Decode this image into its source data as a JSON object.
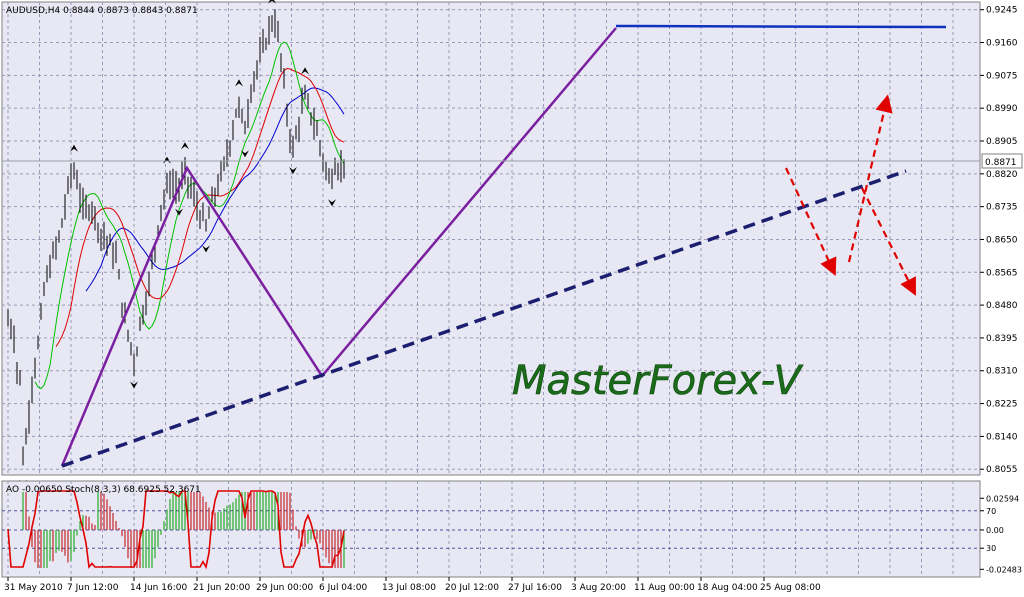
{
  "window": {
    "symbol_line": "AUDUSD,H4  0.8844 0.8873 0.8843 0.8871",
    "watermark": "MasterForex-V",
    "current_price_label": "0.8871",
    "indicator_line": "AO -0.00650  Stoch(8,3,3) 68.6925 52.3671"
  },
  "colors": {
    "background": "#ffffff",
    "plot_bg": "#e8e8f4",
    "grid": "#9a9ab8",
    "candles": "#000000",
    "fractal": "#000000",
    "ma_fast": "#00c000",
    "ma_mid": "#e00000",
    "ma_slow": "#0000d0",
    "zigzag": "#7a1fa0",
    "trend_line": "#1c1f70",
    "resistance": "#1030c0",
    "arrows": "#e00000",
    "watermark": "#1a6b1a",
    "ao_up": "#00a000",
    "ao_down": "#c00000",
    "stoch_main": "#e00000"
  },
  "chart_data": [
    {
      "type": "line",
      "title": "AUDUSD,H4  0.8844 0.8873 0.8843 0.8871",
      "xlabel": "",
      "ylabel": "",
      "x": [
        "31 May 2010",
        "7 Jun 12:00",
        "14 Jun 16:00",
        "21 Jun 20:00",
        "29 Jun 00:00",
        "6 Jul 04:00",
        "13 Jul 08:00",
        "20 Jul 12:00",
        "27 Jul 16:00",
        "3 Aug 20:00",
        "11 Aug 00:00",
        "18 Aug 04:00",
        "25 Aug 08:00"
      ],
      "yticks": [
        0.9245,
        0.916,
        0.9075,
        0.899,
        0.8905,
        0.882,
        0.8735,
        0.865,
        0.8565,
        0.848,
        0.8395,
        0.831,
        0.8225,
        0.814,
        0.8055
      ],
      "ylim": [
        0.804,
        0.9265
      ],
      "grid": true,
      "series": [
        {
          "values": [
            [
              0,
              0.844
            ],
            [
              0.03,
              0.838
            ],
            [
              0.06,
              0.846
            ],
            [
              0.09,
              0.842
            ],
            [
              0.12,
              0.83
            ],
            [
              0.18,
              0.834
            ],
            [
              0.24,
              0.808
            ],
            [
              0.3,
              0.815
            ],
            [
              0.38,
              0.828
            ],
            [
              0.48,
              0.838
            ],
            [
              0.58,
              0.853
            ],
            [
              0.7,
              0.86
            ],
            [
              0.82,
              0.866
            ],
            [
              0.92,
              0.875
            ],
            [
              1.02,
              0.884
            ],
            [
              1.1,
              0.88
            ],
            [
              1.2,
              0.872
            ],
            [
              1.32,
              0.874
            ],
            [
              1.46,
              0.867
            ],
            [
              1.6,
              0.864
            ],
            [
              1.72,
              0.86
            ],
            [
              1.84,
              0.845
            ],
            [
              1.94,
              0.838
            ],
            [
              2.02,
              0.833
            ],
            [
              2.1,
              0.844
            ],
            [
              2.2,
              0.85
            ],
            [
              2.32,
              0.862
            ],
            [
              2.42,
              0.873
            ],
            [
              2.56,
              0.88
            ],
            [
              2.7,
              0.878
            ],
            [
              2.82,
              0.882
            ],
            [
              2.94,
              0.876
            ],
            [
              3.04,
              0.872
            ],
            [
              3.14,
              0.868
            ],
            [
              3.26,
              0.876
            ],
            [
              3.4,
              0.882
            ],
            [
              3.52,
              0.89
            ],
            [
              3.64,
              0.9
            ],
            [
              3.76,
              0.894
            ],
            [
              3.88,
              0.906
            ],
            [
              4.0,
              0.912
            ],
            [
              4.12,
              0.918
            ],
            [
              4.22,
              0.923
            ],
            [
              4.3,
              0.916
            ],
            [
              4.36,
              0.908
            ],
            [
              4.44,
              0.896
            ],
            [
              4.52,
              0.888
            ],
            [
              4.6,
              0.894
            ],
            [
              4.7,
              0.902
            ],
            [
              4.8,
              0.898
            ],
            [
              4.9,
              0.893
            ],
            [
              5.0,
              0.886
            ],
            [
              5.1,
              0.88
            ],
            [
              5.2,
              0.885
            ],
            [
              5.28,
              0.883
            ],
            [
              5.36,
              0.8871
            ]
          ]
        }
      ]
    },
    {
      "type": "line",
      "title": "AO -0.00650  Stoch(8,3,3) 68.6925 52.3671",
      "yticks_right": [
        "0.02594",
        "70",
        "0.00",
        "30",
        "-0.02483"
      ],
      "ylim": [
        -0.02483,
        0.02594
      ],
      "levels": [
        70,
        30
      ],
      "grid": true
    }
  ]
}
